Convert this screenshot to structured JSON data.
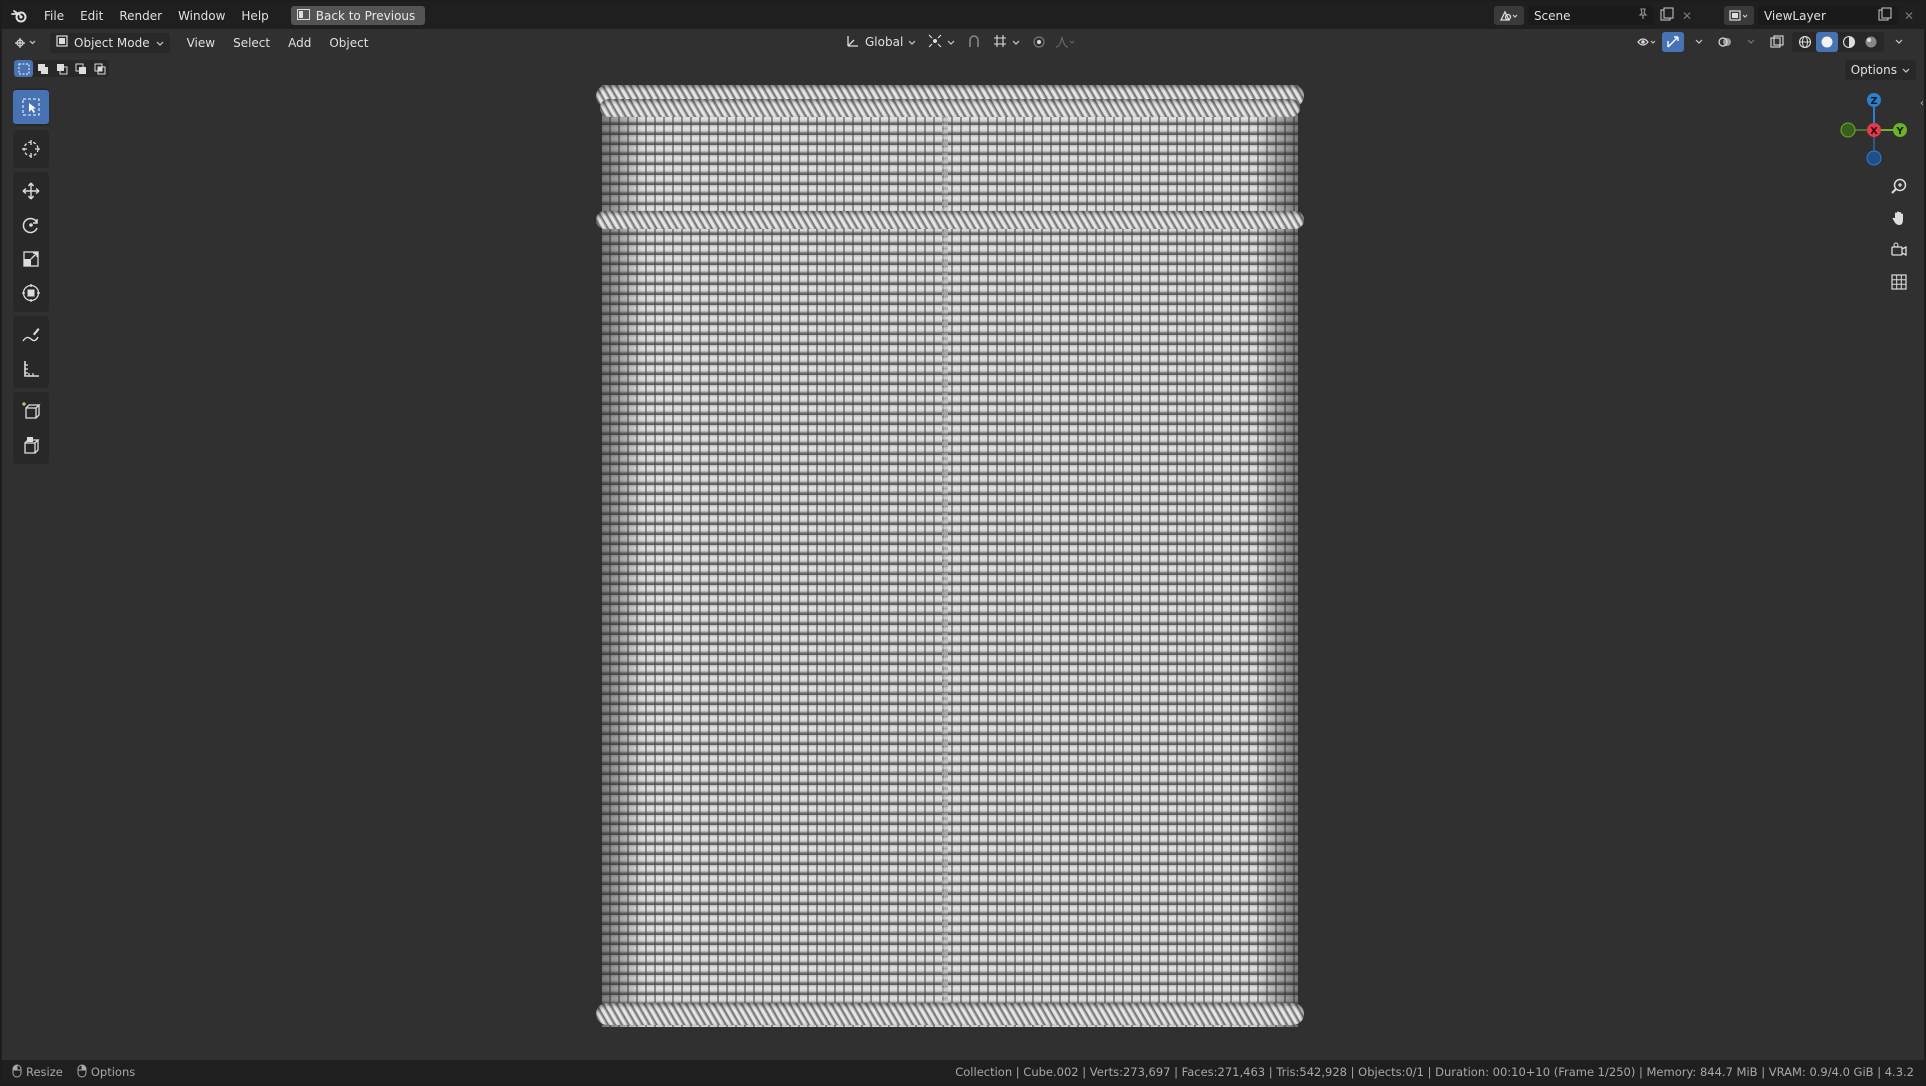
{
  "menubar": {
    "items": [
      "File",
      "Edit",
      "Render",
      "Window",
      "Help"
    ],
    "back_button": "Back to Previous",
    "scene": "Scene",
    "view_layer": "ViewLayer"
  },
  "header": {
    "mode": "Object Mode",
    "menus": [
      "View",
      "Select",
      "Add",
      "Object"
    ],
    "transform_orientation": "Global"
  },
  "options_label": "Options",
  "toolbar": {
    "tools": [
      "select-box",
      "cursor",
      "move",
      "rotate",
      "scale",
      "transform",
      "annotate",
      "measure",
      "add-cube",
      "extrude"
    ],
    "active": "select-box"
  },
  "gizmo": {
    "z": "Z",
    "x": "X",
    "y": "Y"
  },
  "statusbar": {
    "left": [
      "Resize",
      "Options"
    ],
    "right": "Collection | Cube.002 | Verts:273,697 | Faces:271,463 | Tris:542,928 | Objects:0/1 | Duration: 00:10+10 (Frame 1/250) | Memory: 844.7 MiB | VRAM: 0.9/4.0 GiB | 4.3.2"
  },
  "colors": {
    "accent": "#4772b3",
    "viewport_bg": "#303030",
    "axis_x": "#e8384f",
    "axis_y": "#6cb325",
    "axis_z": "#2f7fd1"
  }
}
